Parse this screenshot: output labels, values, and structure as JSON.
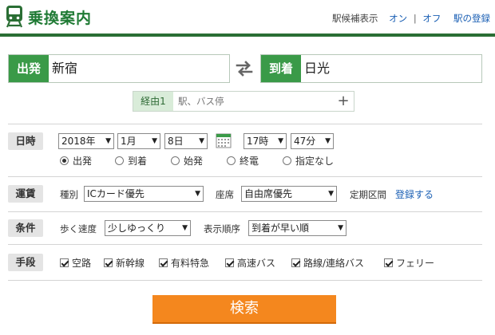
{
  "header": {
    "title": "乗換案内",
    "station_suggest_label": "駅候補表示",
    "on": "オン",
    "separator": "|",
    "off": "オフ",
    "register_station": "駅の登録"
  },
  "route": {
    "from_label": "出発",
    "from_value": "新宿",
    "to_label": "到着",
    "to_value": "日光",
    "via_label": "経由1",
    "via_placeholder": "駅、バス停",
    "via_add": "+"
  },
  "datetime": {
    "label": "日時",
    "year": "2018年",
    "month": "1月",
    "day": "8日",
    "hour": "17時",
    "minute": "47分",
    "options": [
      {
        "label": "出発",
        "selected": true
      },
      {
        "label": "到着",
        "selected": false
      },
      {
        "label": "始発",
        "selected": false
      },
      {
        "label": "終電",
        "selected": false
      },
      {
        "label": "指定なし",
        "selected": false
      }
    ]
  },
  "fare": {
    "label": "運賃",
    "type_label": "種別",
    "type_value": "ICカード優先",
    "seat_label": "座席",
    "seat_value": "自由席優先",
    "commuter_label": "定期区間",
    "commuter_link": "登録する"
  },
  "conditions": {
    "label": "条件",
    "walk_label": "歩く速度",
    "walk_value": "少しゆっくり",
    "order_label": "表示順序",
    "order_value": "到着が早い順"
  },
  "means": {
    "label": "手段",
    "items": [
      {
        "label": "空路",
        "checked": true
      },
      {
        "label": "新幹線",
        "checked": true
      },
      {
        "label": "有料特急",
        "checked": true
      },
      {
        "label": "高速バス",
        "checked": true
      },
      {
        "label": "路線/連絡バス",
        "checked": true
      },
      {
        "label": "フェリー",
        "checked": true
      }
    ]
  },
  "search_button": "検索",
  "colors": {
    "brand_green": "#2a6e34",
    "label_green": "#3a9a48",
    "search_orange": "#f4871e",
    "link_blue": "#1a5fb4"
  },
  "icons": {
    "logo": "train-icon",
    "swap": "swap-arrows-icon",
    "calendar": "calendar-icon",
    "dropdown": "chevron-down-icon"
  }
}
